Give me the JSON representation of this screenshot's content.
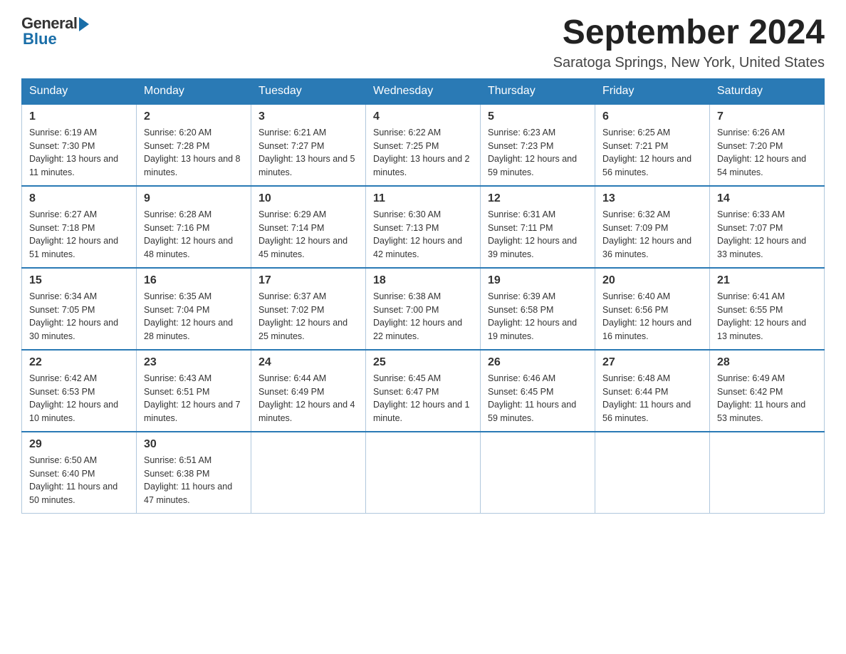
{
  "logo": {
    "general": "General",
    "blue": "Blue"
  },
  "title": "September 2024",
  "location": "Saratoga Springs, New York, United States",
  "weekdays": [
    "Sunday",
    "Monday",
    "Tuesday",
    "Wednesday",
    "Thursday",
    "Friday",
    "Saturday"
  ],
  "weeks": [
    [
      {
        "day": "1",
        "sunrise": "6:19 AM",
        "sunset": "7:30 PM",
        "daylight": "13 hours and 11 minutes."
      },
      {
        "day": "2",
        "sunrise": "6:20 AM",
        "sunset": "7:28 PM",
        "daylight": "13 hours and 8 minutes."
      },
      {
        "day": "3",
        "sunrise": "6:21 AM",
        "sunset": "7:27 PM",
        "daylight": "13 hours and 5 minutes."
      },
      {
        "day": "4",
        "sunrise": "6:22 AM",
        "sunset": "7:25 PM",
        "daylight": "13 hours and 2 minutes."
      },
      {
        "day": "5",
        "sunrise": "6:23 AM",
        "sunset": "7:23 PM",
        "daylight": "12 hours and 59 minutes."
      },
      {
        "day": "6",
        "sunrise": "6:25 AM",
        "sunset": "7:21 PM",
        "daylight": "12 hours and 56 minutes."
      },
      {
        "day": "7",
        "sunrise": "6:26 AM",
        "sunset": "7:20 PM",
        "daylight": "12 hours and 54 minutes."
      }
    ],
    [
      {
        "day": "8",
        "sunrise": "6:27 AM",
        "sunset": "7:18 PM",
        "daylight": "12 hours and 51 minutes."
      },
      {
        "day": "9",
        "sunrise": "6:28 AM",
        "sunset": "7:16 PM",
        "daylight": "12 hours and 48 minutes."
      },
      {
        "day": "10",
        "sunrise": "6:29 AM",
        "sunset": "7:14 PM",
        "daylight": "12 hours and 45 minutes."
      },
      {
        "day": "11",
        "sunrise": "6:30 AM",
        "sunset": "7:13 PM",
        "daylight": "12 hours and 42 minutes."
      },
      {
        "day": "12",
        "sunrise": "6:31 AM",
        "sunset": "7:11 PM",
        "daylight": "12 hours and 39 minutes."
      },
      {
        "day": "13",
        "sunrise": "6:32 AM",
        "sunset": "7:09 PM",
        "daylight": "12 hours and 36 minutes."
      },
      {
        "day": "14",
        "sunrise": "6:33 AM",
        "sunset": "7:07 PM",
        "daylight": "12 hours and 33 minutes."
      }
    ],
    [
      {
        "day": "15",
        "sunrise": "6:34 AM",
        "sunset": "7:05 PM",
        "daylight": "12 hours and 30 minutes."
      },
      {
        "day": "16",
        "sunrise": "6:35 AM",
        "sunset": "7:04 PM",
        "daylight": "12 hours and 28 minutes."
      },
      {
        "day": "17",
        "sunrise": "6:37 AM",
        "sunset": "7:02 PM",
        "daylight": "12 hours and 25 minutes."
      },
      {
        "day": "18",
        "sunrise": "6:38 AM",
        "sunset": "7:00 PM",
        "daylight": "12 hours and 22 minutes."
      },
      {
        "day": "19",
        "sunrise": "6:39 AM",
        "sunset": "6:58 PM",
        "daylight": "12 hours and 19 minutes."
      },
      {
        "day": "20",
        "sunrise": "6:40 AM",
        "sunset": "6:56 PM",
        "daylight": "12 hours and 16 minutes."
      },
      {
        "day": "21",
        "sunrise": "6:41 AM",
        "sunset": "6:55 PM",
        "daylight": "12 hours and 13 minutes."
      }
    ],
    [
      {
        "day": "22",
        "sunrise": "6:42 AM",
        "sunset": "6:53 PM",
        "daylight": "12 hours and 10 minutes."
      },
      {
        "day": "23",
        "sunrise": "6:43 AM",
        "sunset": "6:51 PM",
        "daylight": "12 hours and 7 minutes."
      },
      {
        "day": "24",
        "sunrise": "6:44 AM",
        "sunset": "6:49 PM",
        "daylight": "12 hours and 4 minutes."
      },
      {
        "day": "25",
        "sunrise": "6:45 AM",
        "sunset": "6:47 PM",
        "daylight": "12 hours and 1 minute."
      },
      {
        "day": "26",
        "sunrise": "6:46 AM",
        "sunset": "6:45 PM",
        "daylight": "11 hours and 59 minutes."
      },
      {
        "day": "27",
        "sunrise": "6:48 AM",
        "sunset": "6:44 PM",
        "daylight": "11 hours and 56 minutes."
      },
      {
        "day": "28",
        "sunrise": "6:49 AM",
        "sunset": "6:42 PM",
        "daylight": "11 hours and 53 minutes."
      }
    ],
    [
      {
        "day": "29",
        "sunrise": "6:50 AM",
        "sunset": "6:40 PM",
        "daylight": "11 hours and 50 minutes."
      },
      {
        "day": "30",
        "sunrise": "6:51 AM",
        "sunset": "6:38 PM",
        "daylight": "11 hours and 47 minutes."
      },
      null,
      null,
      null,
      null,
      null
    ]
  ]
}
